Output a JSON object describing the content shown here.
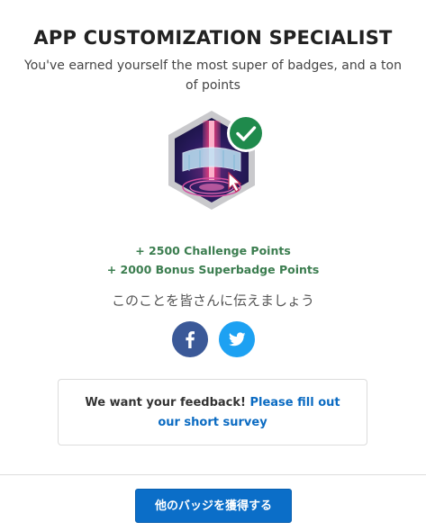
{
  "header": {
    "title": "APP CUSTOMIZATION SPECIALIST",
    "subtitle": "You've earned yourself the most super of badges, and a ton of points"
  },
  "badge": {
    "icon": "superbadge-hex-icon",
    "status_icon": "check-circle-icon",
    "status_color": "#1f8a4c"
  },
  "points": {
    "challenge": "+ 2500 Challenge Points",
    "bonus": "+ 2000 Bonus Superbadge Points",
    "color": "#3b7d4f"
  },
  "share": {
    "label": "このことを皆さんに伝えましょう",
    "facebook_icon": "facebook-icon",
    "twitter_icon": "twitter-icon",
    "facebook_color": "#3b5998",
    "twitter_color": "#1da1f2"
  },
  "feedback": {
    "prompt": "We want your feedback!",
    "link_label": "Please fill out our short survey",
    "link_color": "#0b6bc2"
  },
  "cta": {
    "label": "他のバッジを獲得する",
    "color": "#0b6ec8"
  }
}
